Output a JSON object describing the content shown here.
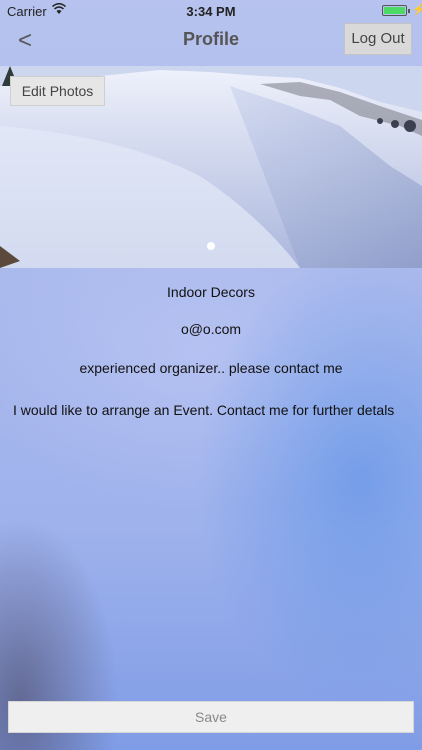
{
  "status_bar": {
    "carrier": "Carrier",
    "time": "3:34 PM",
    "battery_level": 1.0
  },
  "nav": {
    "back_icon": "chevron-left-icon",
    "back_glyph": "<",
    "title": "Profile",
    "logout_label": "Log Out"
  },
  "photo": {
    "edit_label": "Edit Photos"
  },
  "profile": {
    "name": "Indoor Decors",
    "email": "o@o.com",
    "tagline": "experienced organizer.. please contact me",
    "description": "I would like to arrange an Event. Contact me for further detals"
  },
  "footer": {
    "save_label": "Save"
  },
  "colors": {
    "battery": "#4cd964",
    "background_blue": "#9fb2ec"
  }
}
